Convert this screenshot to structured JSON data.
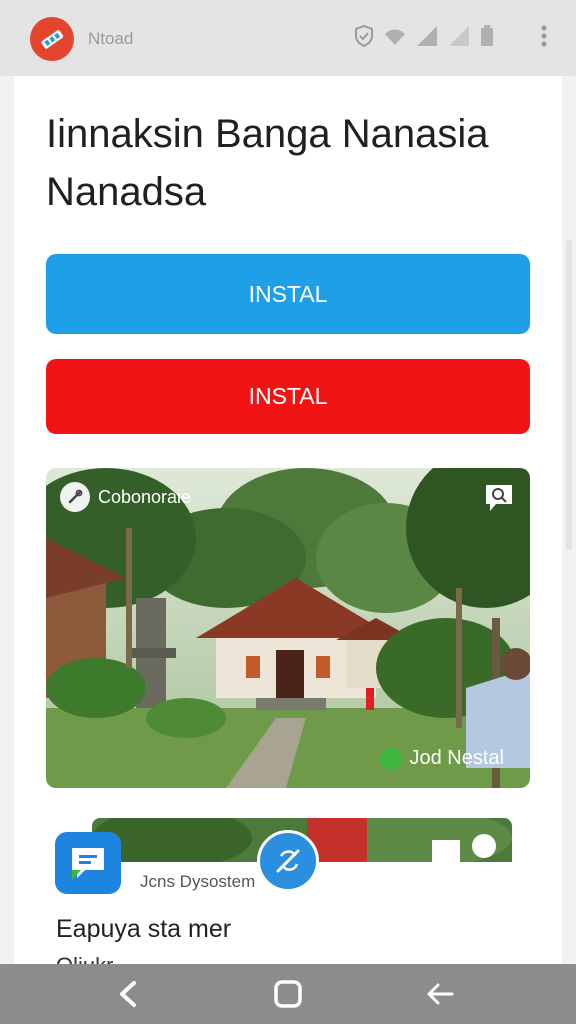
{
  "status_bar": {
    "app_name": "Ntoad",
    "icons": [
      "shield-icon",
      "wifi-icon",
      "signal-icon",
      "signal-icon",
      "battery-icon",
      "more-vert-icon"
    ]
  },
  "main": {
    "title": "Iinnaksin Banga Nanasia Nanadsa",
    "install_button_primary": "INSTAL",
    "install_button_secondary": "INSTAL",
    "colors": {
      "primary_button": "#1e9fe8",
      "secondary_button": "#f21414",
      "app_icon": "#e5442e"
    }
  },
  "featured_card": {
    "category": "Cobonoraie",
    "credit": "Jod Nestal",
    "icons": [
      "wrench-icon",
      "chat-bubble-icon",
      "green-dot-icon"
    ]
  },
  "second_card": {
    "subtitle": "Jcns Dysostem",
    "heading": "Eapuya sta mer",
    "heading_partial": "Oliukr"
  },
  "nav_bar": {
    "icons": [
      "back-icon",
      "home-icon",
      "return-icon"
    ]
  }
}
